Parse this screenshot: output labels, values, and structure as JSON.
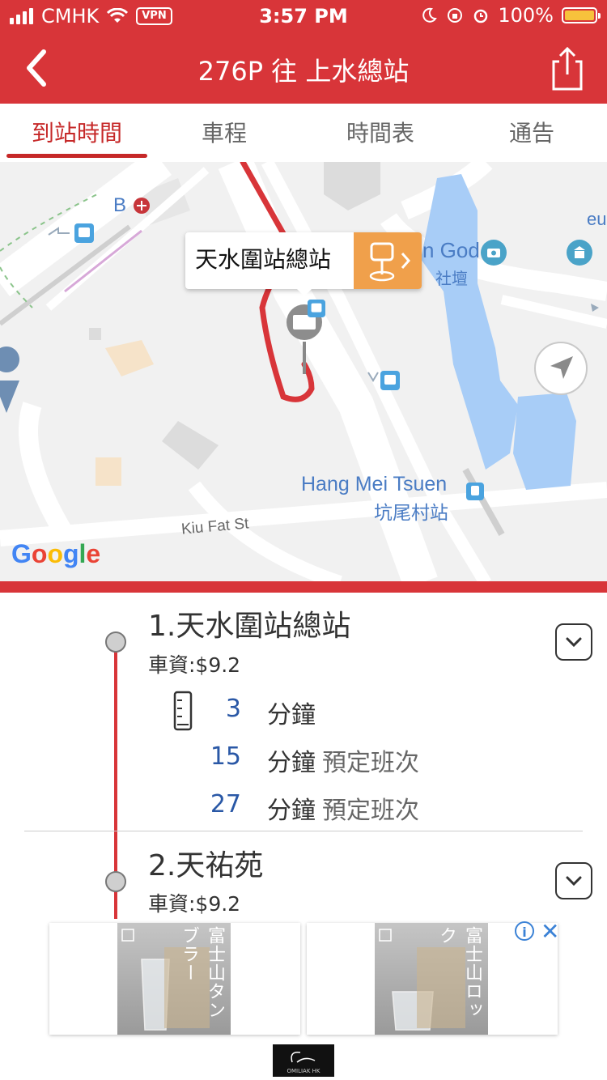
{
  "status_bar": {
    "carrier": "CMHK",
    "vpn": "VPN",
    "time": "3:57 PM",
    "battery": "100%",
    "battery_level": 1.0,
    "battery_color": "#f7c23c"
  },
  "nav": {
    "title": "276P 往 上水總站",
    "back_icon": "chevron-left-icon",
    "share_icon": "share-icon"
  },
  "tabs": [
    {
      "label": "到站時間",
      "active": true
    },
    {
      "label": "車程",
      "active": false
    },
    {
      "label": "時間表",
      "active": false
    },
    {
      "label": "通告",
      "active": false
    }
  ],
  "map": {
    "labels": {
      "station_letter": "B",
      "god_text": "n God",
      "shrine": "社壇",
      "edge_text": "eu",
      "hang_mei_en": "Hang Mei Tsuen",
      "hang_mei_zh": "坑尾村站",
      "kiu_fat": "Kiu Fat St"
    },
    "callout": {
      "title": "天水圍站總站",
      "button_icon": "bus-stop-icon"
    },
    "google": [
      "G",
      "o",
      "o",
      "g",
      "l",
      "e"
    ],
    "google_colors": [
      "#4285F4",
      "#EA4335",
      "#FBBC05",
      "#4285F4",
      "#34A853",
      "#EA4335"
    ]
  },
  "stops": [
    {
      "name": "1.天水圍站總站",
      "fare": "車資:$9.2",
      "etas": [
        {
          "minutes": "3",
          "unit": "分鐘",
          "note": ""
        },
        {
          "minutes": "15",
          "unit": "分鐘",
          "note": "預定班次"
        },
        {
          "minutes": "27",
          "unit": "分鐘",
          "note": "預定班次"
        }
      ]
    },
    {
      "name": "2.天祐苑",
      "fare": "車資:$9.2",
      "etas": []
    }
  ],
  "ad": {
    "card1_text": "富士山タンブラー",
    "card2_text": "富士山ロック",
    "info": "i",
    "close": "✕",
    "brand": "OMILIAK HK"
  },
  "colors": {
    "brand_red": "#d83539",
    "eta_blue": "#2a58a6",
    "callout_orange": "#f0a04b"
  }
}
